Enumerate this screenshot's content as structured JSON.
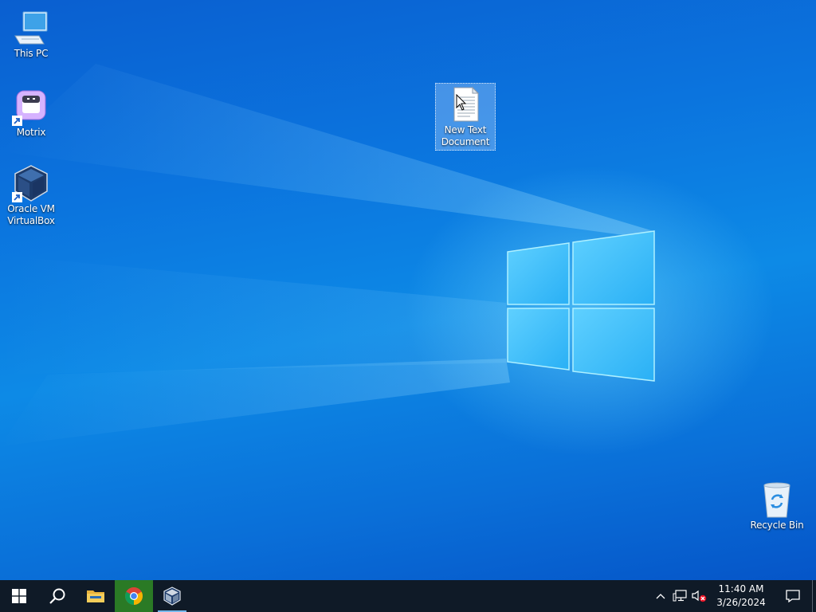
{
  "desktop": {
    "icons": [
      {
        "label": "This PC",
        "icon": "computer-icon"
      },
      {
        "label": "Motrix",
        "icon": "motrix-icon",
        "shortcut": true
      },
      {
        "label": "Oracle VM VirtualBox",
        "icon": "virtualbox-icon",
        "shortcut": true
      },
      {
        "label": "New Text Document",
        "icon": "text-document-icon",
        "selected": true
      },
      {
        "label": "Recycle Bin",
        "icon": "recycle-bin-icon"
      }
    ],
    "wallpaper": "windows-10-logo-wallpaper"
  },
  "taskbar": {
    "start_icon": "windows-start-icon",
    "search_icon": "search-icon",
    "pinned": [
      {
        "name": "File Explorer",
        "icon": "file-explorer-icon"
      },
      {
        "name": "Google Chrome",
        "icon": "chrome-icon",
        "active": true
      },
      {
        "name": "Oracle VM VirtualBox",
        "icon": "virtualbox-icon",
        "running": true
      }
    ],
    "tray": {
      "chevron_icon": "chevron-up-icon",
      "network_icon": "network-icon",
      "volume_icon": "volume-muted-icon",
      "time": "11:40 AM",
      "date": "3/26/2024",
      "notification_icon": "action-center-icon"
    }
  },
  "colors": {
    "taskbar_bg": "#0f1a27",
    "active_app": "#2a7a25",
    "running_indicator": "#76b9ed"
  }
}
